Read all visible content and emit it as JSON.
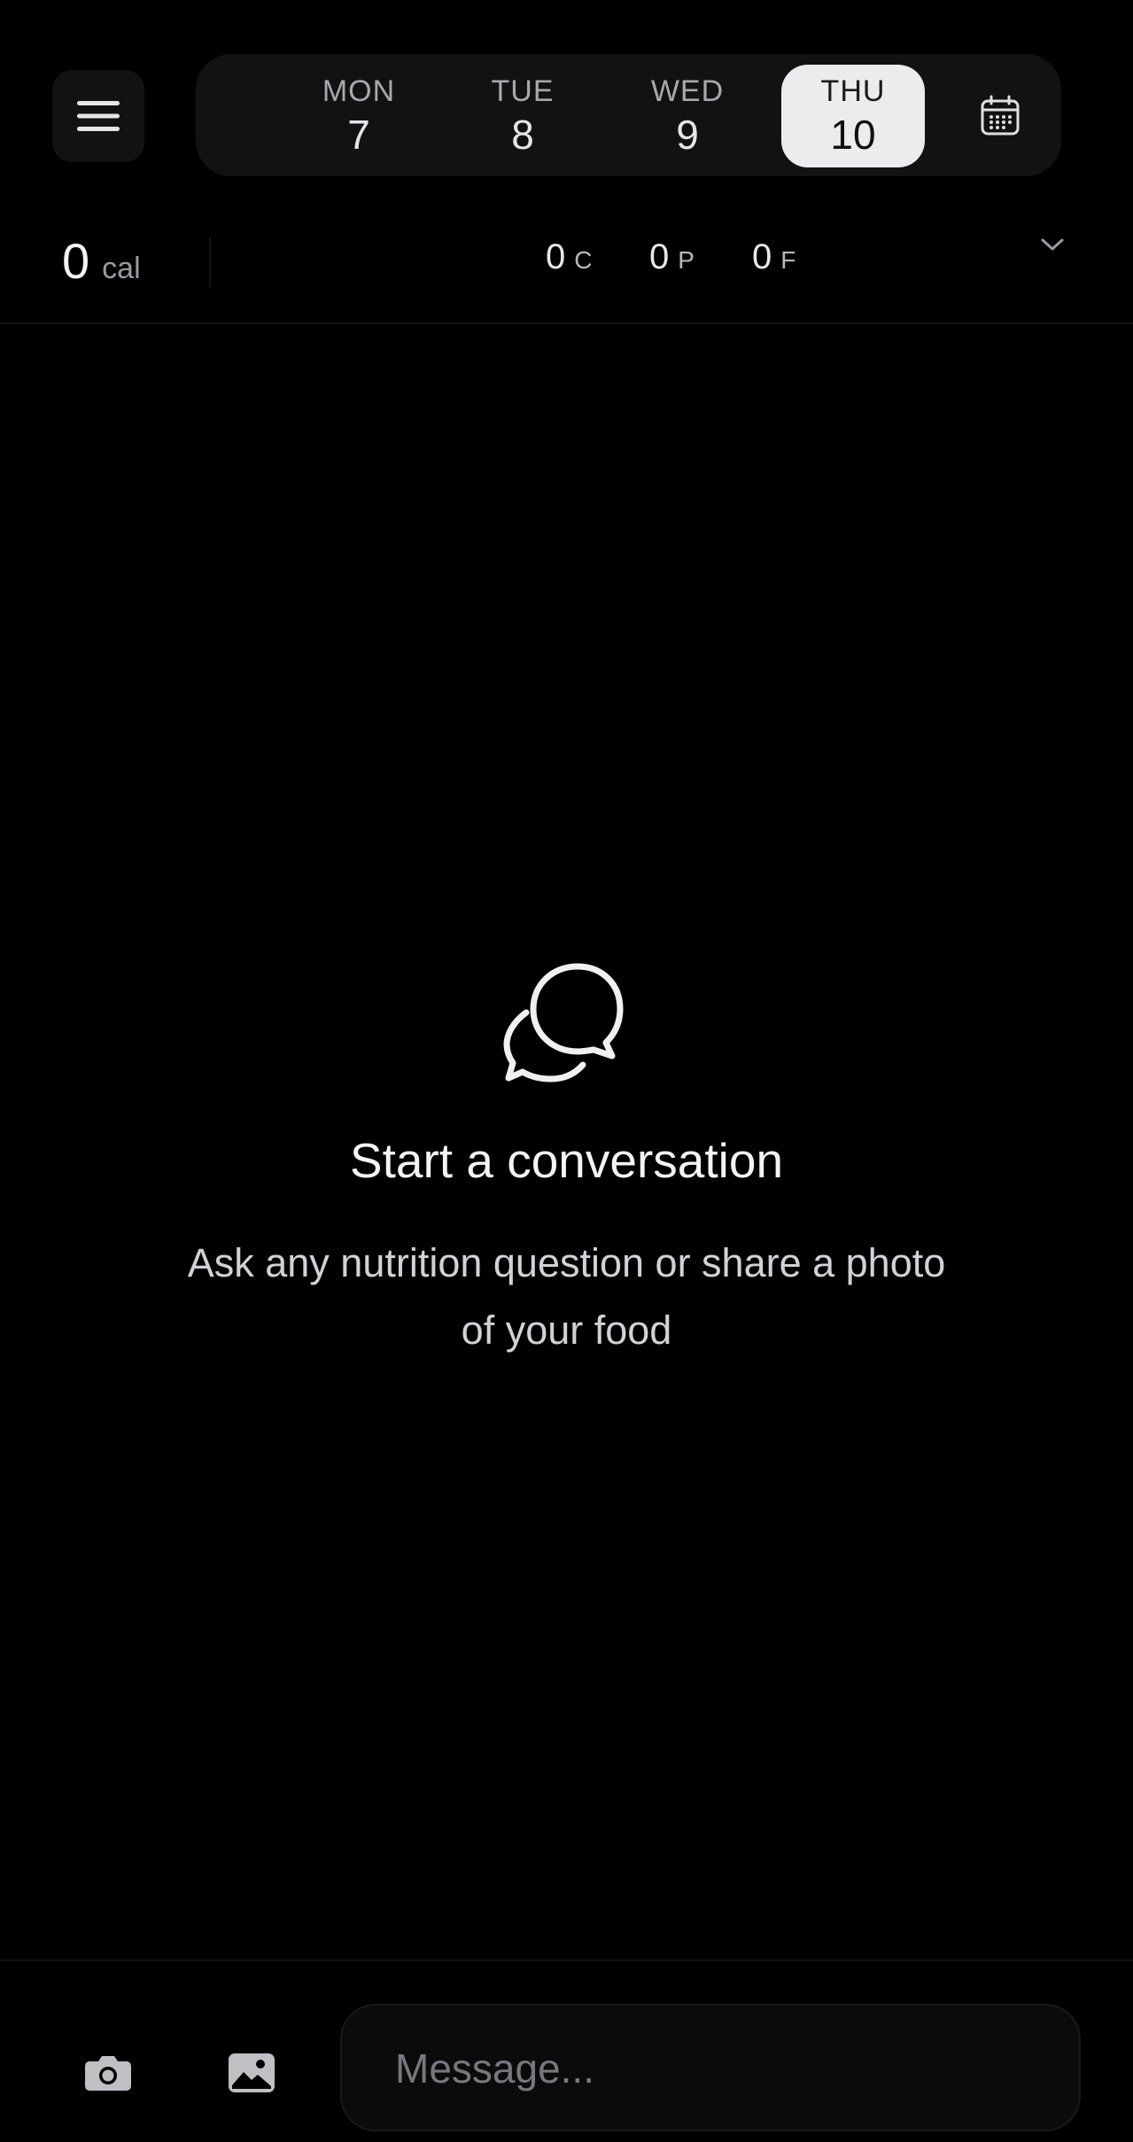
{
  "header": {
    "days": [
      {
        "dow": "MON",
        "num": "7"
      },
      {
        "dow": "TUE",
        "num": "8"
      },
      {
        "dow": "WED",
        "num": "9"
      },
      {
        "dow": "THU",
        "num": "10",
        "selected": true
      }
    ]
  },
  "summary": {
    "calories_value": "0",
    "calories_unit": "cal",
    "carbs_value": "0",
    "carbs_unit": "C",
    "protein_value": "0",
    "protein_unit": "P",
    "fat_value": "0",
    "fat_unit": "F"
  },
  "empty_state": {
    "title": "Start a conversation",
    "subtitle_line1": "Ask any nutrition question or share a photo",
    "subtitle_line2": "of your food"
  },
  "composer": {
    "placeholder": "Message..."
  },
  "icons": {
    "menu": "menu-icon",
    "calendar": "calendar-icon",
    "expand": "chevron-down-icon",
    "chat": "chat-bubbles-icon",
    "camera": "camera-icon",
    "photo": "image-icon"
  },
  "colors": {
    "background": "#000000",
    "surface": "#121212",
    "selected_day": "#ececef",
    "muted_text": "#a8a8ad"
  }
}
